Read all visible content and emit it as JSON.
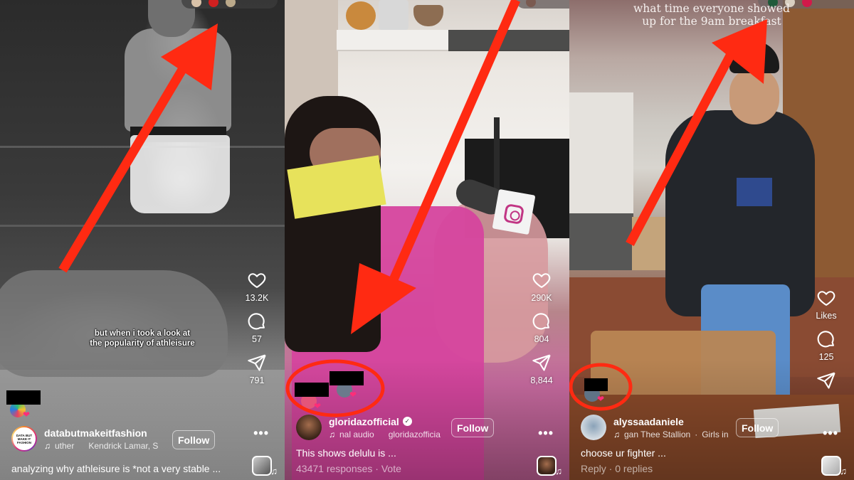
{
  "panels": [
    {
      "id": "reel-1",
      "overlay_caption": [
        "but when i took a look at",
        "the popularity of athleisure"
      ],
      "actions": {
        "like_count": "13.2K",
        "comment_count": "57",
        "share_count": "791"
      },
      "user": {
        "username": "databutmakeitfashion",
        "avatar_text": "DATA BUT MAKE IT FASHION",
        "audio_track": "uther",
        "audio_artist": "Kendrick Lamar, S",
        "follow_label": "Follow",
        "verified": false
      },
      "description": "analyzing why athleisure is *not a very stable ...",
      "more_label": "•••",
      "annotation": "arrow pointing up-right to top reactions bar"
    },
    {
      "id": "reel-2",
      "actions": {
        "like_count": "290K",
        "comment_count": "804",
        "share_count": "8,844"
      },
      "user": {
        "username": "gloridazofficial",
        "audio_track": "nal audio",
        "audio_artist": "gloridazofficia",
        "follow_label": "Follow",
        "verified": true
      },
      "description": "This shows delulu is ...",
      "sub_line": "43471 responses · Vote",
      "more_label": "•••",
      "annotation": "arrow pointing down-left to circled friend avatars"
    },
    {
      "id": "reel-3",
      "overlay_caption": [
        "what time everyone showed",
        "up for the 9am breakfast"
      ],
      "actions": {
        "like_count": "Likes",
        "comment_count": "125",
        "share_count": ""
      },
      "user": {
        "username": "alyssaadaniele",
        "audio_track": "gan Thee Stallion",
        "audio_artist": "Girls in",
        "follow_label": "Follow",
        "verified": false
      },
      "description": "choose ur fighter ...",
      "sub_line": "Reply · 0 replies",
      "more_label": "•••",
      "annotation": "arrow pointing up-right to top reactions bar; circled friend avatar"
    }
  ],
  "colors": {
    "annotation_red": "#ff2a12",
    "heart_pink": "#ff2d78",
    "text_white": "#ffffff"
  },
  "icons": {
    "like": "heart-outline-icon",
    "comment": "speech-bubble-icon",
    "share": "paper-plane-icon",
    "more": "ellipsis-icon",
    "audio": "music-note-icon",
    "verified": "verified-badge-icon"
  }
}
